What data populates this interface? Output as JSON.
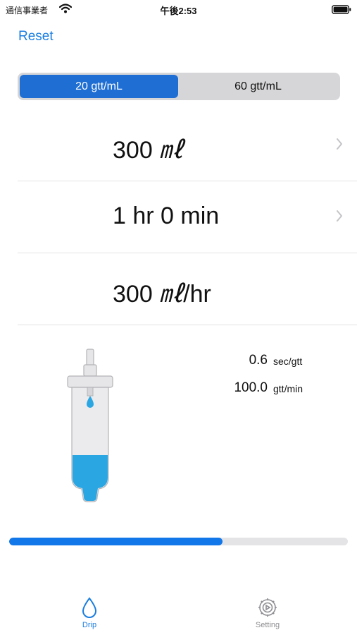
{
  "status_bar": {
    "carrier": "通信事業者",
    "time": "午後2:53",
    "icons": [
      "wifi-icon",
      "battery-icon"
    ]
  },
  "header": {
    "reset_label": "Reset"
  },
  "drop_factor": {
    "options": [
      "20 gtt/mL",
      "60 gtt/mL"
    ],
    "selected": "20 gtt/mL"
  },
  "volume": {
    "number": "300",
    "unit": "㎖"
  },
  "duration": {
    "text": "1 hr 0 min"
  },
  "rate": {
    "number": "300",
    "unit": "㎖",
    "suffix": "/hr"
  },
  "stats": {
    "interval_value": "0.6",
    "interval_unit": "sec/gtt",
    "drops_value": "100.0",
    "drops_unit": "gtt/min"
  },
  "progress": {
    "fraction": 0.63
  },
  "colors": {
    "accent": "#1a7ee0",
    "segment_selected": "#1e6ed3",
    "fluid": "#2aa6e3",
    "progress": "#1277e8"
  },
  "tabbar": {
    "drip_label": "Drip",
    "setting_label": "Setting",
    "active": "Drip",
    "icons": [
      "drop-icon",
      "gear-icon"
    ]
  }
}
